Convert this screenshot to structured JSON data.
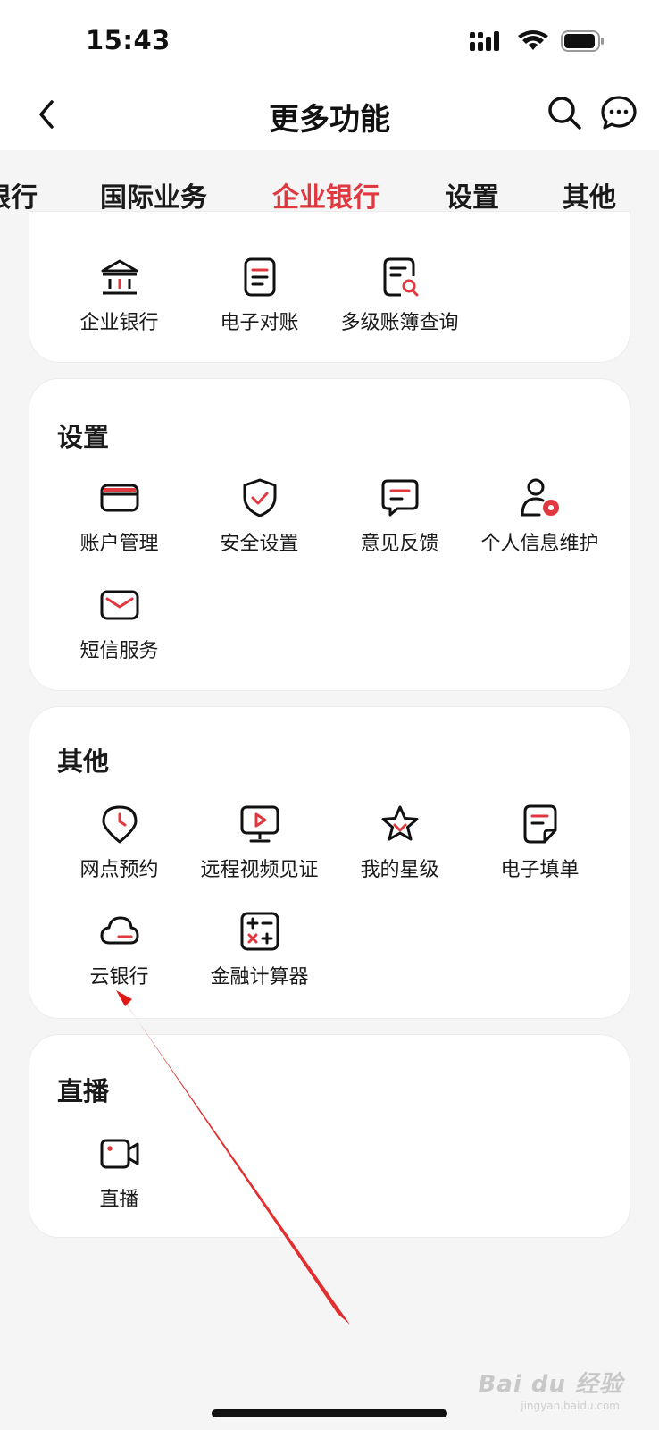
{
  "status_bar": {
    "time": "15:43",
    "icons": [
      "signal-icon",
      "wifi-icon",
      "battery-icon"
    ]
  },
  "nav": {
    "title": "更多功能",
    "icons": [
      "back-icon",
      "search-icon",
      "chat-icon"
    ]
  },
  "tabs": [
    {
      "label": "银行"
    },
    {
      "label": "国际业务"
    },
    {
      "label": "企业银行",
      "active": true
    },
    {
      "label": "设置"
    },
    {
      "label": "其他"
    }
  ],
  "sections": {
    "enterprise": {
      "items": [
        {
          "label": "企业银行",
          "icon": "bank-icon"
        },
        {
          "label": "电子对账",
          "icon": "document-icon"
        },
        {
          "label": "多级账簿查询",
          "icon": "document-search-icon"
        }
      ]
    },
    "settings": {
      "title": "设置",
      "items": [
        {
          "label": "账户管理",
          "icon": "card-icon"
        },
        {
          "label": "安全设置",
          "icon": "shield-check-icon"
        },
        {
          "label": "意见反馈",
          "icon": "feedback-icon"
        },
        {
          "label": "个人信息维护",
          "icon": "user-settings-icon"
        },
        {
          "label": "短信服务",
          "icon": "envelope-icon"
        }
      ]
    },
    "other": {
      "title": "其他",
      "items": [
        {
          "label": "网点预约",
          "icon": "location-clock-icon"
        },
        {
          "label": "远程视频见证",
          "icon": "video-screen-icon"
        },
        {
          "label": "我的星级",
          "icon": "star-icon"
        },
        {
          "label": "电子填单",
          "icon": "form-icon"
        },
        {
          "label": "云银行",
          "icon": "cloud-icon"
        },
        {
          "label": "金融计算器",
          "icon": "calculator-icon"
        }
      ]
    },
    "live": {
      "title": "直播",
      "items": [
        {
          "label": "直播",
          "icon": "camera-icon"
        }
      ]
    }
  },
  "watermark": {
    "text": "Bai du 经验",
    "sub": "jingyan.baidu.com"
  },
  "colors": {
    "accent": "#e0383e",
    "text": "#1a1a1a",
    "background": "#f5f5f5",
    "card": "#ffffff"
  }
}
